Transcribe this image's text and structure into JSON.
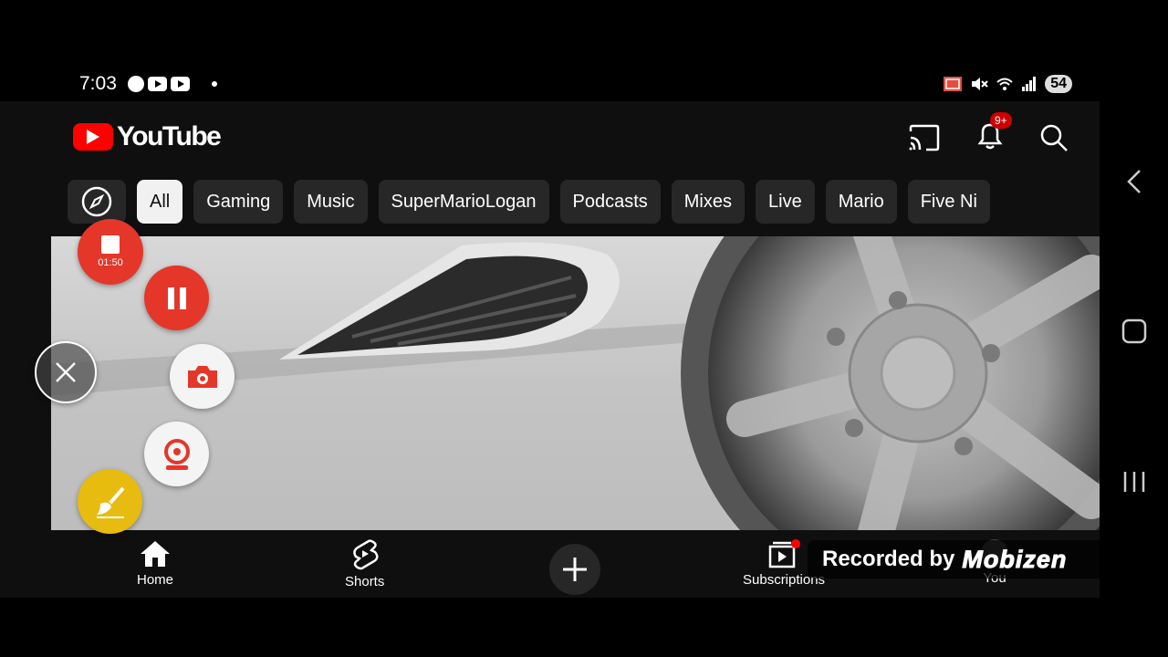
{
  "status_bar": {
    "time": "7:03",
    "battery": "54"
  },
  "header": {
    "app_name": "YouTube",
    "notification_count": "9+"
  },
  "chips": [
    {
      "label": "All",
      "active": true
    },
    {
      "label": "Gaming"
    },
    {
      "label": "Music"
    },
    {
      "label": "SuperMarioLogan"
    },
    {
      "label": "Podcasts"
    },
    {
      "label": "Mixes"
    },
    {
      "label": "Live"
    },
    {
      "label": "Mario"
    },
    {
      "label": "Five Ni"
    }
  ],
  "bottom_nav": {
    "home": "Home",
    "shorts": "Shorts",
    "subscriptions": "Subscriptions",
    "you": "You"
  },
  "recorder": {
    "elapsed": "01:50"
  },
  "watermark": {
    "text": "Recorded by",
    "logo": "Mobizen"
  },
  "colors": {
    "youtube_red": "#ff0000",
    "recorder_red": "#e4372a",
    "brush_yellow": "#e8bb10",
    "chip_bg": "#272727"
  }
}
